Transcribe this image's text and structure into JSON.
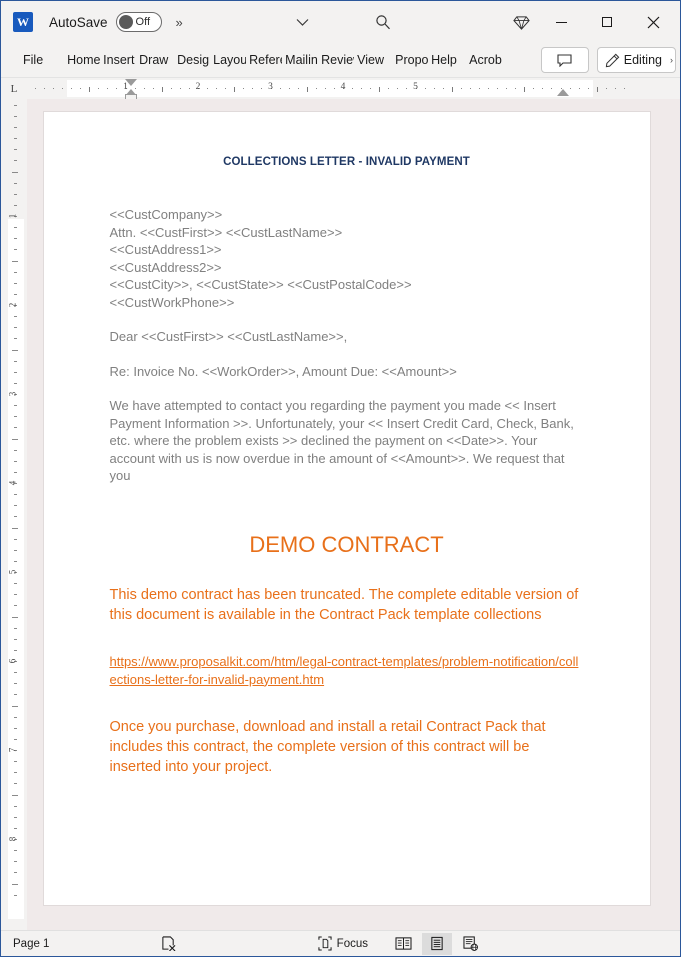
{
  "titlebar": {
    "app_icon": "word-icon",
    "autosave_label": "AutoSave",
    "autosave_state": "Off",
    "more_label": "»",
    "chevron_icon": "chevron-down-icon",
    "search_icon": "search-icon",
    "diamond_icon": "diamond-icon",
    "minimize_label": "—",
    "maximize_label": "□",
    "close_label": "✕"
  },
  "ribbon": {
    "tabs": [
      {
        "label": "File",
        "name": "tab-file"
      },
      {
        "label": "Home",
        "name": "tab-home"
      },
      {
        "label": "Insert",
        "name": "tab-insert"
      },
      {
        "label": "Draw",
        "name": "tab-draw"
      },
      {
        "label": "Design",
        "name": "tab-design"
      },
      {
        "label": "Layout",
        "name": "tab-layout"
      },
      {
        "label": "References",
        "name": "tab-references"
      },
      {
        "label": "Mailings",
        "name": "tab-mailings"
      },
      {
        "label": "Review",
        "name": "tab-review"
      },
      {
        "label": "View",
        "name": "tab-view"
      },
      {
        "label": "Proposal",
        "name": "tab-proposal"
      },
      {
        "label": "Help",
        "name": "tab-help"
      },
      {
        "label": "Acrobat",
        "name": "tab-acrobat"
      }
    ],
    "comment_icon": "comment-icon",
    "editing_label": "Editing",
    "editing_icon": "pencil-icon",
    "editing_caret": "›"
  },
  "ruler": {
    "tabstop_marker": "L",
    "numbers": [
      "1",
      "2",
      "3",
      "4",
      "5"
    ],
    "vertical_numbers": [
      "1",
      "2",
      "3",
      "4",
      "5",
      "6",
      "7",
      "8"
    ]
  },
  "document": {
    "title": "COLLECTIONS LETTER - INVALID PAYMENT",
    "address_block": [
      "<<CustCompany>>",
      "Attn. <<CustFirst>> <<CustLastName>>",
      "<<CustAddress1>>",
      "<<CustAddress2>>",
      "<<CustCity>>, <<CustState>> <<CustPostalCode>>",
      "<<CustWorkPhone>>"
    ],
    "salutation": "Dear <<CustFirst>> <<CustLastName>>,",
    "reference_line": "Re: Invoice No. <<WorkOrder>>, Amount Due: <<Amount>>",
    "body_paragraph": "We have attempted to contact you regarding the payment you made << Insert Payment Information >>. Unfortunately, your << Insert Credit Card, Check, Bank, etc. where the problem exists >> declined the payment on <<Date>>. Your account with us is now overdue in the amount of <<Amount>>. We request that you",
    "demo_title": "DEMO CONTRACT",
    "demo_paragraph_1": "This demo contract has been truncated. The complete editable version of this document is available in the Contract Pack template collections",
    "demo_link": "https://www.proposalkit.com/htm/legal-contract-templates/problem-notification/collections-letter-for-invalid-payment.htm",
    "demo_paragraph_2": "Once you purchase, download and install a retail Contract Pack that includes this contract, the complete version of this contract will be inserted into your project."
  },
  "statusbar": {
    "page_label": "Page 1",
    "proofing_icon": "proofing-errors-icon",
    "focus_label": "Focus",
    "focus_icon": "focus-icon",
    "read_mode_icon": "read-mode-icon",
    "print_layout_icon": "print-layout-icon",
    "web_layout_icon": "web-layout-icon"
  },
  "colors": {
    "heading_navy": "#1f3864",
    "demo_orange": "#e8701a",
    "merge_field_gray": "#808080",
    "word_blue": "#185abd",
    "window_border": "#2b579a"
  }
}
